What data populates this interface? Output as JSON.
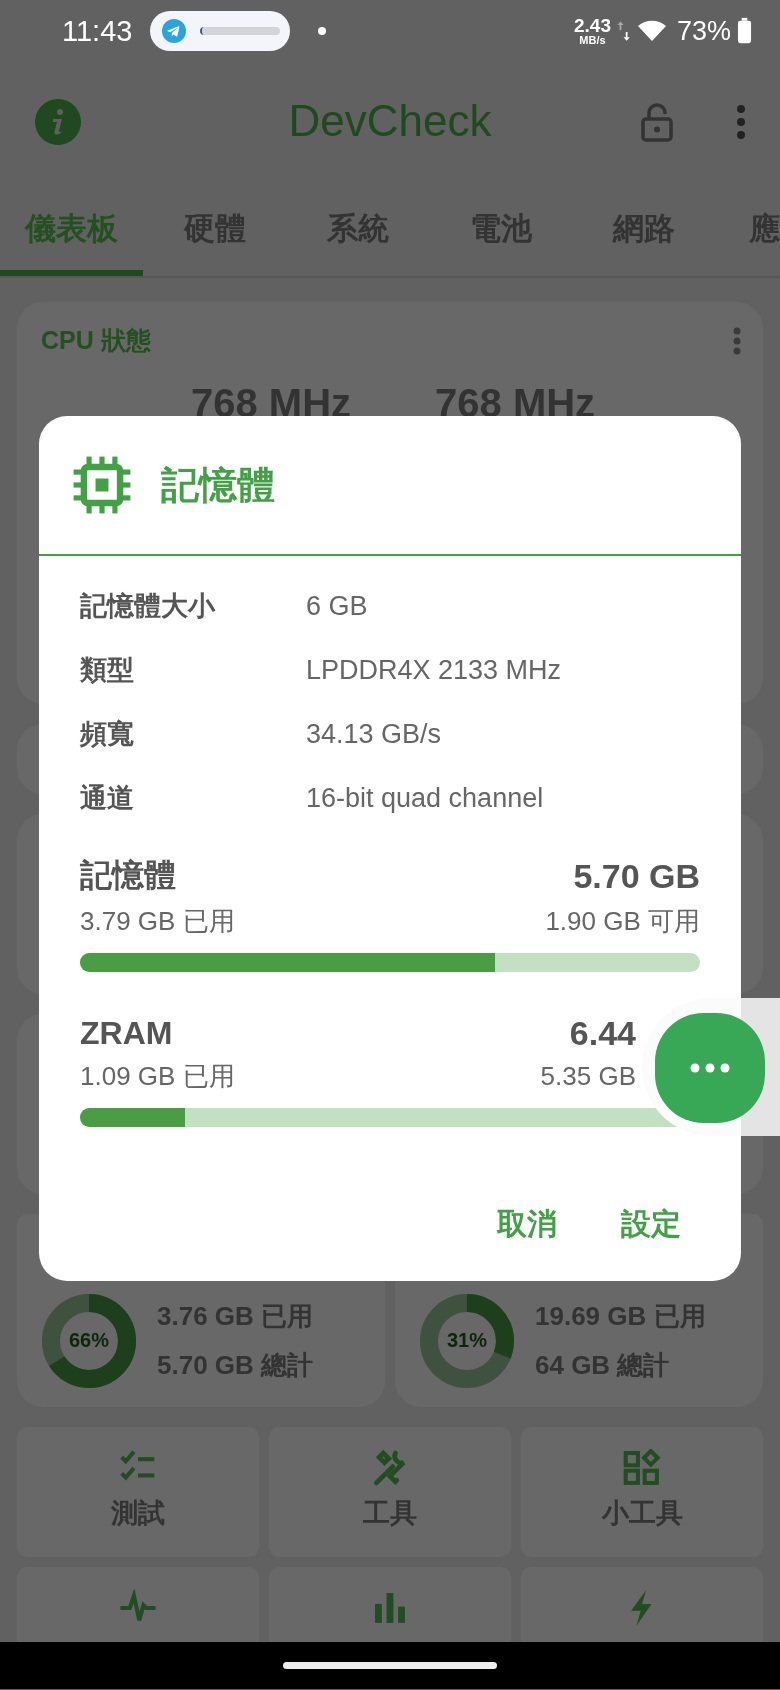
{
  "status_bar": {
    "time": "11:43",
    "net_speed": "2.43",
    "net_unit": "MB/s",
    "battery": "73%"
  },
  "app_bar": {
    "title": "DevCheck"
  },
  "tabs": [
    {
      "label": "儀表板",
      "selected": true
    },
    {
      "label": "硬體",
      "selected": false
    },
    {
      "label": "系統",
      "selected": false
    },
    {
      "label": "電池",
      "selected": false
    },
    {
      "label": "網路",
      "selected": false
    },
    {
      "label": "應",
      "selected": false
    }
  ],
  "cpu_card": {
    "title": "CPU 狀態",
    "frequencies": [
      "768 MHz",
      "768 MHz"
    ]
  },
  "storage_cards": [
    {
      "percent": "66%",
      "level": 0.66,
      "used": "3.76 GB 已用",
      "total": "5.70 GB 總計"
    },
    {
      "percent": "31%",
      "level": 0.31,
      "used": "19.69 GB 已用",
      "total": "64 GB 總計"
    }
  ],
  "tiles": [
    {
      "kind": "checklist",
      "label": "測試"
    },
    {
      "kind": "tools",
      "label": "工具"
    },
    {
      "kind": "widgets",
      "label": "小工具"
    },
    {
      "kind": "pulse"
    },
    {
      "kind": "bars"
    },
    {
      "kind": "bolt"
    }
  ],
  "dialog": {
    "title": "記憶體",
    "info_rows": [
      {
        "label": "記憶體大小",
        "value": "6 GB"
      },
      {
        "label": "類型",
        "value": "LPDDR4X 2133 MHz"
      },
      {
        "label": "頻寬",
        "value": "34.13 GB/s"
      },
      {
        "label": "通道",
        "value": "16-bit quad channel"
      }
    ],
    "usage": [
      {
        "name": "記憶體",
        "total": "5.70 GB",
        "used": "3.79 GB 已用",
        "free": "1.90 GB 可用",
        "level": 0.67
      },
      {
        "name": "ZRAM",
        "total": "6.44",
        "used": "1.09 GB 已用",
        "free": "5.35 GB",
        "level": 0.17
      }
    ],
    "buttons": [
      "取消",
      "設定"
    ]
  }
}
